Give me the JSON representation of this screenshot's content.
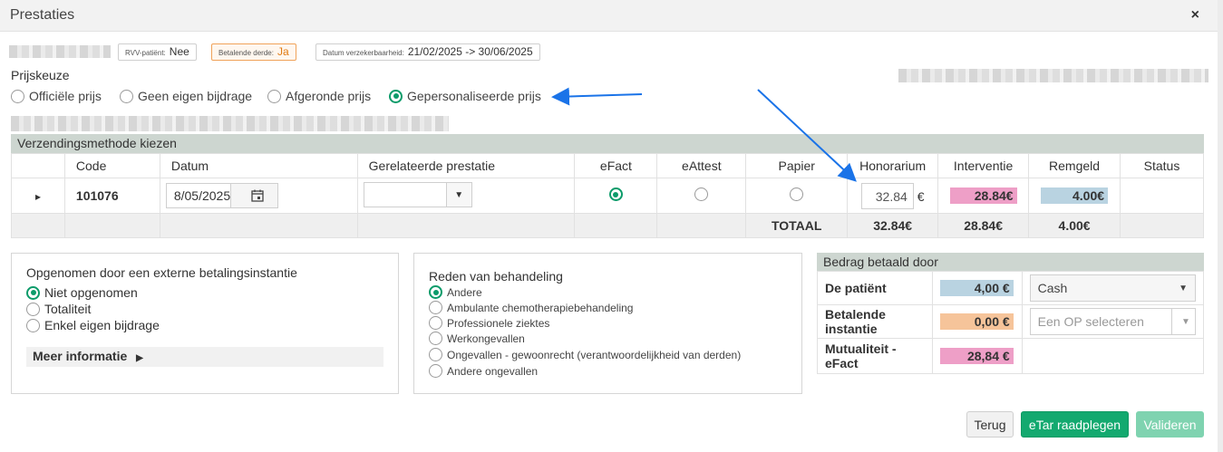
{
  "window": {
    "title": "Prestaties",
    "close_label": "×"
  },
  "chips": [
    {
      "key": "RVV-patiënt:",
      "value": "Nee"
    },
    {
      "key": "Betalende derde:",
      "value": "Ja"
    },
    {
      "key": "Datum verzekerbaarheid:",
      "value": "21/02/2025 -> 30/06/2025"
    }
  ],
  "prijskeuze": {
    "label": "Prijskeuze",
    "options": [
      "Officiële prijs",
      "Geen eigen bijdrage",
      "Afgeronde prijs",
      "Gepersonaliseerde prijs"
    ],
    "selected": "Gepersonaliseerde prijs"
  },
  "verzending": {
    "header": "Verzendingsmethode kiezen",
    "columns": [
      "Code",
      "Datum",
      "Gerelateerde prestatie",
      "eFact",
      "eAttest",
      "Papier",
      "Honorarium",
      "Interventie",
      "Remgeld",
      "Status"
    ],
    "row": {
      "expand_icon": "▸",
      "code": "101076",
      "datum": "8/05/2025",
      "gerelateerde": "",
      "method_selected": "eFact",
      "honorarium": "32.84",
      "currency": "€",
      "interventie": "28.84€",
      "remgeld": "4.00€"
    },
    "totaal": {
      "label": "TOTAAL",
      "honorarium": "32.84€",
      "interventie": "28.84€",
      "remgeld": "4.00€"
    }
  },
  "opgenomen": {
    "title": "Opgenomen door een externe betalingsinstantie",
    "options": [
      "Niet opgenomen",
      "Totaliteit",
      "Enkel eigen bijdrage"
    ],
    "selected": "Niet opgenomen",
    "meer": "Meer informatie"
  },
  "reden": {
    "title": "Reden van behandeling",
    "options": [
      "Andere",
      "Ambulante chemotherapiebehandeling",
      "Professionele ziektes",
      "Werkongevallen",
      "Ongevallen - gewoonrecht (verantwoordelijkheid van derden)",
      "Andere ongevallen"
    ],
    "selected": "Andere"
  },
  "bedrag": {
    "header": "Bedrag betaald door",
    "rows": [
      {
        "label": "De patiënt",
        "amount": "4,00 €",
        "select": "Cash",
        "placeholder": ""
      },
      {
        "label": "Betalende instantie",
        "amount": "0,00 €",
        "select": "",
        "placeholder": "Een OP selecteren"
      },
      {
        "label": "Mutualiteit - eFact",
        "amount": "28,84 €",
        "select": "",
        "placeholder": ""
      }
    ]
  },
  "buttons": {
    "terug": "Terug",
    "etar": "eTar raadplegen",
    "valideren": "Valideren"
  },
  "colors": {
    "accent_green": "#13a96f",
    "interventie_bg": "#ee9fc7",
    "remgeld_bg": "#b9d3e1",
    "instantie_bg": "#f6c49a",
    "arrow": "#1a73e8"
  }
}
